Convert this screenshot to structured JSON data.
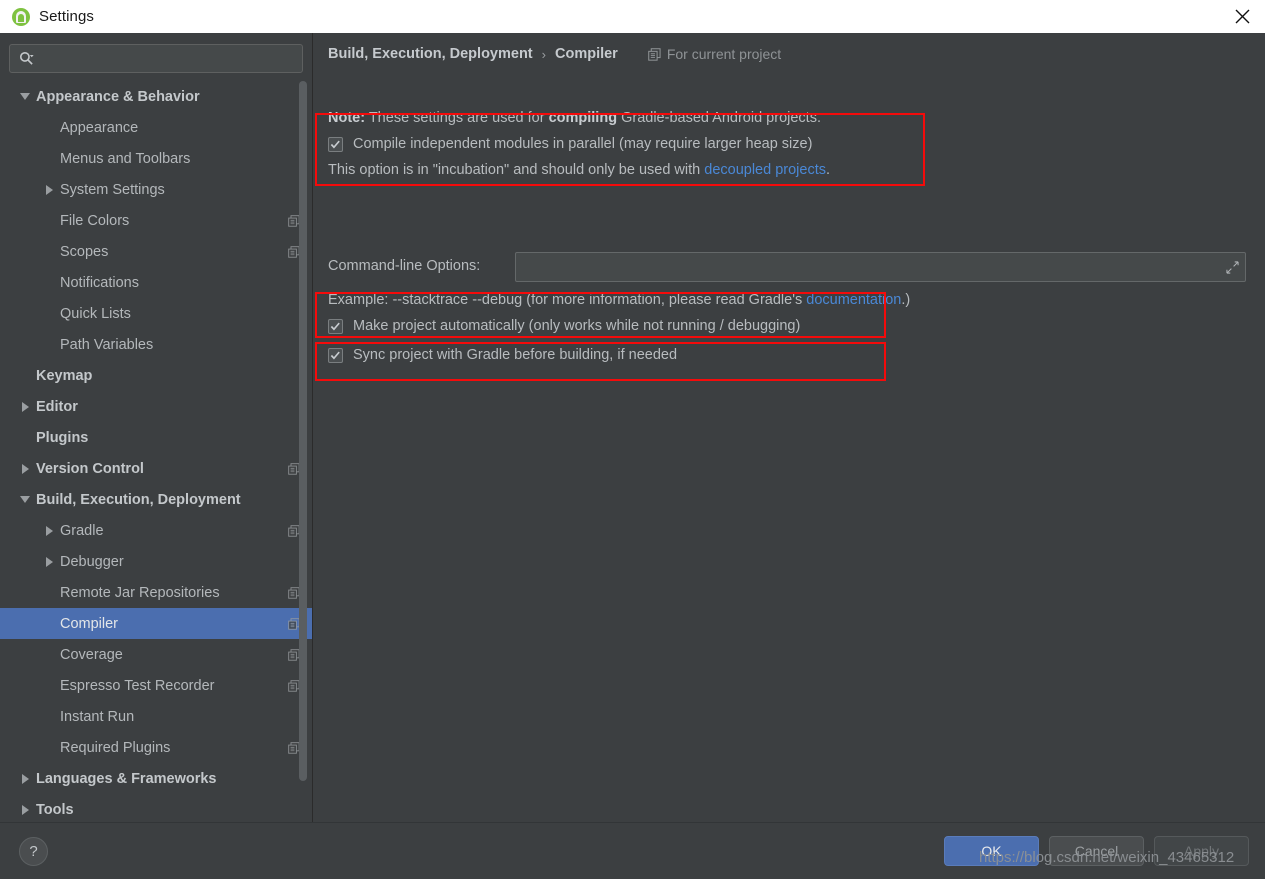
{
  "window": {
    "title": "Settings",
    "app_icon": "android-studio-icon",
    "close_icon": "close-icon"
  },
  "sidebar": {
    "search": {
      "icon": "search-icon",
      "value": "",
      "placeholder": ""
    },
    "items": [
      {
        "label": "Appearance & Behavior",
        "indent": 0,
        "twisty": "down",
        "bold": true,
        "config": false,
        "selected": false
      },
      {
        "label": "Appearance",
        "indent": 1,
        "twisty": "none",
        "bold": false,
        "config": false,
        "selected": false
      },
      {
        "label": "Menus and Toolbars",
        "indent": 1,
        "twisty": "none",
        "bold": false,
        "config": false,
        "selected": false
      },
      {
        "label": "System Settings",
        "indent": 1,
        "twisty": "right",
        "bold": false,
        "config": false,
        "selected": false
      },
      {
        "label": "File Colors",
        "indent": 1,
        "twisty": "none",
        "bold": false,
        "config": true,
        "selected": false
      },
      {
        "label": "Scopes",
        "indent": 1,
        "twisty": "none",
        "bold": false,
        "config": true,
        "selected": false
      },
      {
        "label": "Notifications",
        "indent": 1,
        "twisty": "none",
        "bold": false,
        "config": false,
        "selected": false
      },
      {
        "label": "Quick Lists",
        "indent": 1,
        "twisty": "none",
        "bold": false,
        "config": false,
        "selected": false
      },
      {
        "label": "Path Variables",
        "indent": 1,
        "twisty": "none",
        "bold": false,
        "config": false,
        "selected": false
      },
      {
        "label": "Keymap",
        "indent": 0,
        "twisty": "none",
        "bold": true,
        "config": false,
        "selected": false
      },
      {
        "label": "Editor",
        "indent": 0,
        "twisty": "right",
        "bold": true,
        "config": false,
        "selected": false
      },
      {
        "label": "Plugins",
        "indent": 0,
        "twisty": "none",
        "bold": true,
        "config": false,
        "selected": false
      },
      {
        "label": "Version Control",
        "indent": 0,
        "twisty": "right",
        "bold": true,
        "config": true,
        "selected": false
      },
      {
        "label": "Build, Execution, Deployment",
        "indent": 0,
        "twisty": "down",
        "bold": true,
        "config": false,
        "selected": false
      },
      {
        "label": "Gradle",
        "indent": 1,
        "twisty": "right",
        "bold": false,
        "config": true,
        "selected": false
      },
      {
        "label": "Debugger",
        "indent": 1,
        "twisty": "right",
        "bold": false,
        "config": false,
        "selected": false
      },
      {
        "label": "Remote Jar Repositories",
        "indent": 1,
        "twisty": "none",
        "bold": false,
        "config": true,
        "selected": false
      },
      {
        "label": "Compiler",
        "indent": 1,
        "twisty": "none",
        "bold": false,
        "config": true,
        "selected": true
      },
      {
        "label": "Coverage",
        "indent": 1,
        "twisty": "none",
        "bold": false,
        "config": true,
        "selected": false
      },
      {
        "label": "Espresso Test Recorder",
        "indent": 1,
        "twisty": "none",
        "bold": false,
        "config": true,
        "selected": false
      },
      {
        "label": "Instant Run",
        "indent": 1,
        "twisty": "none",
        "bold": false,
        "config": false,
        "selected": false
      },
      {
        "label": "Required Plugins",
        "indent": 1,
        "twisty": "none",
        "bold": false,
        "config": true,
        "selected": false
      },
      {
        "label": "Languages & Frameworks",
        "indent": 0,
        "twisty": "right",
        "bold": true,
        "config": false,
        "selected": false
      },
      {
        "label": "Tools",
        "indent": 0,
        "twisty": "right",
        "bold": true,
        "config": false,
        "selected": false
      }
    ]
  },
  "main": {
    "breadcrumb": {
      "parent": "Build, Execution, Deployment",
      "separator": "›",
      "current": "Compiler",
      "scope_icon": "copy-config-icon",
      "scope_label": "For current project"
    },
    "note": {
      "prefix": "Note:",
      "text_1": " These settings are used for ",
      "emphasis": "compiling",
      "text_2": " Gradle-based Android projects."
    },
    "option_parallel": {
      "checked": true,
      "label": "Compile independent modules in parallel (may require larger heap size)",
      "sub_text_1": "This option is in \"incubation\" and should only be used with ",
      "sub_link": "decoupled projects",
      "sub_text_2": "."
    },
    "command_line": {
      "label": "Command-line Options:",
      "value": "",
      "placeholder": "",
      "expand_icon": "expand-arrows-icon"
    },
    "example": {
      "text_1": "Example: --stacktrace --debug (for more information, please read Gradle's ",
      "link": "documentation",
      "text_2": ".)"
    },
    "option_make_auto": {
      "checked": true,
      "label": "Make project automatically (only works while not running / debugging)"
    },
    "option_sync": {
      "checked": true,
      "label": "Sync project with Gradle before building, if needed"
    }
  },
  "footer": {
    "help_label": "?",
    "ok_label": "OK",
    "cancel_label": "Cancel",
    "apply_label": "Apply"
  },
  "watermark": "https://blog.csdn.net/weixin_43465312",
  "colors": {
    "background": "#3c3f41",
    "selection": "#4b6eaf",
    "highlight_box": "#f50b0b",
    "link": "#4a88d6",
    "titlebar": "#ffffff",
    "brand_green": "#7fc241"
  }
}
